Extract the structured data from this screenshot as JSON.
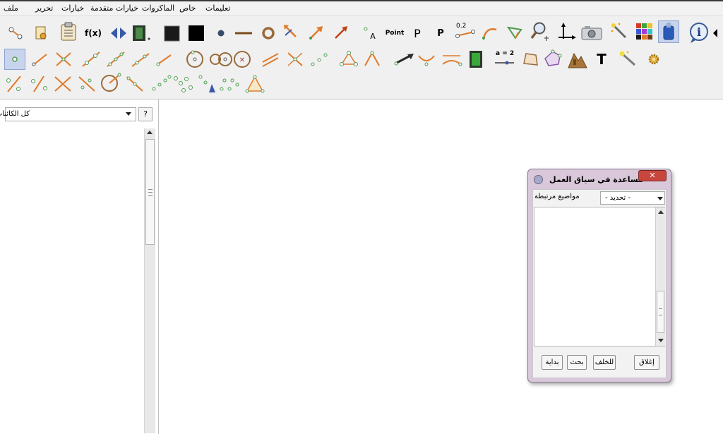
{
  "menu": {
    "file": "ملف",
    "edit": "تحرير",
    "options": "خيارات",
    "advanced_options": "خيارات متقدمة",
    "macros": "الماكروات",
    "special": "خاص",
    "help": "تعليمات"
  },
  "toolbar": {
    "fx_label": "f(x)",
    "point_label": "Point",
    "a_label": "A",
    "p_label_1": "P",
    "p_label_2": "P",
    "number_label": "0.2",
    "a_eq_label": "a = 2",
    "t_label": "T"
  },
  "sidebar": {
    "filter_value": "كل الكائنات",
    "help_button": "?"
  },
  "dialog": {
    "title": "مساعدة في سياق العمل",
    "close_symbol": "✕",
    "related_label": "مواضيع مرتبطة",
    "select_value": "- تحديد -",
    "buttons": {
      "close": "إغلاق",
      "back": "للخلف",
      "search": "بحث",
      "home": "بداية"
    }
  },
  "colors": {
    "accent_orange": "#e07a2a",
    "accent_green": "#4d9b4d",
    "dialog_frame": "#d9c7da",
    "close_red": "#c8463c"
  }
}
